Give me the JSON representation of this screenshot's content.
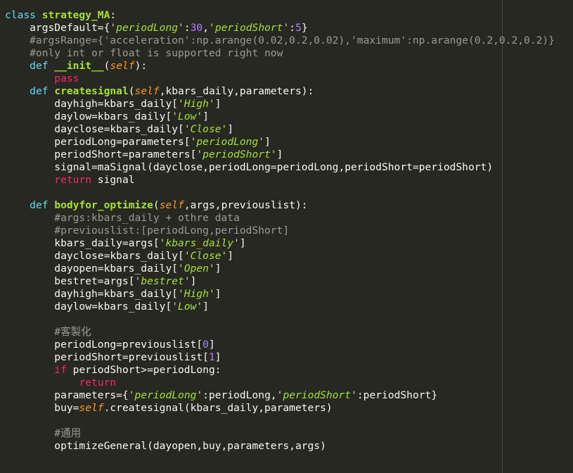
{
  "editor": {
    "lines": [
      [
        {
          "t": "class ",
          "c": "kw"
        },
        {
          "t": "strategy_MA",
          "c": "cls"
        },
        {
          "t": ":",
          "c": "plain"
        }
      ],
      [
        {
          "t": "    argsDefault={",
          "c": "plain"
        },
        {
          "t": "'",
          "c": "strq"
        },
        {
          "t": "periodLong",
          "c": "str"
        },
        {
          "t": "'",
          "c": "strq"
        },
        {
          "t": ":",
          "c": "plain"
        },
        {
          "t": "30",
          "c": "num"
        },
        {
          "t": ",",
          "c": "plain"
        },
        {
          "t": "'",
          "c": "strq"
        },
        {
          "t": "periodShort",
          "c": "str"
        },
        {
          "t": "'",
          "c": "strq"
        },
        {
          "t": ":",
          "c": "plain"
        },
        {
          "t": "5",
          "c": "num"
        },
        {
          "t": "}",
          "c": "plain"
        }
      ],
      [
        {
          "t": "    #argsRange={'acceleration':np.arange(0.02,0.2,0.02),'maximum':np.arange(0.2,0.2,0.2)}",
          "c": "cmt"
        }
      ],
      [
        {
          "t": "    #only int or float is supported right now",
          "c": "cmt"
        }
      ],
      [
        {
          "t": "    ",
          "c": "plain"
        },
        {
          "t": "def ",
          "c": "kw"
        },
        {
          "t": "__init__",
          "c": "fn"
        },
        {
          "t": "(",
          "c": "plain"
        },
        {
          "t": "self",
          "c": "self"
        },
        {
          "t": "):",
          "c": "plain"
        }
      ],
      [
        {
          "t": "        ",
          "c": "plain"
        },
        {
          "t": "pass",
          "c": "kw2"
        }
      ],
      [
        {
          "t": "    ",
          "c": "plain"
        },
        {
          "t": "def ",
          "c": "kw"
        },
        {
          "t": "createsignal",
          "c": "fn"
        },
        {
          "t": "(",
          "c": "plain"
        },
        {
          "t": "self",
          "c": "self"
        },
        {
          "t": ",kbars_daily,parameters):",
          "c": "plain"
        }
      ],
      [
        {
          "t": "        dayhigh=kbars_daily[",
          "c": "plain"
        },
        {
          "t": "'",
          "c": "strq"
        },
        {
          "t": "High",
          "c": "str"
        },
        {
          "t": "'",
          "c": "strq"
        },
        {
          "t": "]",
          "c": "plain"
        }
      ],
      [
        {
          "t": "        daylow=kbars_daily[",
          "c": "plain"
        },
        {
          "t": "'",
          "c": "strq"
        },
        {
          "t": "Low",
          "c": "str"
        },
        {
          "t": "'",
          "c": "strq"
        },
        {
          "t": "]",
          "c": "plain"
        }
      ],
      [
        {
          "t": "        dayclose=kbars_daily[",
          "c": "plain"
        },
        {
          "t": "'",
          "c": "strq"
        },
        {
          "t": "Close",
          "c": "str"
        },
        {
          "t": "'",
          "c": "strq"
        },
        {
          "t": "]",
          "c": "plain"
        }
      ],
      [
        {
          "t": "        periodLong=parameters[",
          "c": "plain"
        },
        {
          "t": "'",
          "c": "strq"
        },
        {
          "t": "periodLong",
          "c": "str"
        },
        {
          "t": "'",
          "c": "strq"
        },
        {
          "t": "]",
          "c": "plain"
        }
      ],
      [
        {
          "t": "        periodShort=parameters[",
          "c": "plain"
        },
        {
          "t": "'",
          "c": "strq"
        },
        {
          "t": "periodShort",
          "c": "str"
        },
        {
          "t": "'",
          "c": "strq"
        },
        {
          "t": "]",
          "c": "plain"
        }
      ],
      [
        {
          "t": "        signal=maSignal(dayclose,periodLong=periodLong,periodShort=periodShort)",
          "c": "plain"
        }
      ],
      [
        {
          "t": "        ",
          "c": "plain"
        },
        {
          "t": "return",
          "c": "kw2"
        },
        {
          "t": " signal",
          "c": "plain"
        }
      ],
      [],
      [
        {
          "t": "    ",
          "c": "plain"
        },
        {
          "t": "def ",
          "c": "kw"
        },
        {
          "t": "bodyfor_optimize",
          "c": "fn"
        },
        {
          "t": "(",
          "c": "plain"
        },
        {
          "t": "self",
          "c": "self"
        },
        {
          "t": ",args,previouslist):",
          "c": "plain"
        }
      ],
      [
        {
          "t": "        #args:kbars_daily + othre data",
          "c": "cmt"
        }
      ],
      [
        {
          "t": "        #previouslist:[periodLong,periodShort]",
          "c": "cmt"
        }
      ],
      [
        {
          "t": "        kbars_daily=args[",
          "c": "plain"
        },
        {
          "t": "'",
          "c": "strq"
        },
        {
          "t": "kbars_daily",
          "c": "str"
        },
        {
          "t": "'",
          "c": "strq"
        },
        {
          "t": "]",
          "c": "plain"
        }
      ],
      [
        {
          "t": "        dayclose=kbars_daily[",
          "c": "plain"
        },
        {
          "t": "'",
          "c": "strq"
        },
        {
          "t": "Close",
          "c": "str"
        },
        {
          "t": "'",
          "c": "strq"
        },
        {
          "t": "]",
          "c": "plain"
        }
      ],
      [
        {
          "t": "        dayopen=kbars_daily[",
          "c": "plain"
        },
        {
          "t": "'",
          "c": "strq"
        },
        {
          "t": "Open",
          "c": "str"
        },
        {
          "t": "'",
          "c": "strq"
        },
        {
          "t": "]",
          "c": "plain"
        }
      ],
      [
        {
          "t": "        bestret=args[",
          "c": "plain"
        },
        {
          "t": "'",
          "c": "strq"
        },
        {
          "t": "bestret",
          "c": "str"
        },
        {
          "t": "'",
          "c": "strq"
        },
        {
          "t": "]",
          "c": "plain"
        }
      ],
      [
        {
          "t": "        dayhigh=kbars_daily[",
          "c": "plain"
        },
        {
          "t": "'",
          "c": "strq"
        },
        {
          "t": "High",
          "c": "str"
        },
        {
          "t": "'",
          "c": "strq"
        },
        {
          "t": "]",
          "c": "plain"
        }
      ],
      [
        {
          "t": "        daylow=kbars_daily[",
          "c": "plain"
        },
        {
          "t": "'",
          "c": "strq"
        },
        {
          "t": "Low",
          "c": "str"
        },
        {
          "t": "'",
          "c": "strq"
        },
        {
          "t": "]",
          "c": "plain"
        }
      ],
      [],
      [
        {
          "t": "        #客製化",
          "c": "cmt"
        }
      ],
      [
        {
          "t": "        periodLong=previouslist[",
          "c": "plain"
        },
        {
          "t": "0",
          "c": "num"
        },
        {
          "t": "]",
          "c": "plain"
        }
      ],
      [
        {
          "t": "        periodShort=previouslist[",
          "c": "plain"
        },
        {
          "t": "1",
          "c": "num"
        },
        {
          "t": "]",
          "c": "plain"
        }
      ],
      [
        {
          "t": "        ",
          "c": "plain"
        },
        {
          "t": "if",
          "c": "kw2"
        },
        {
          "t": " periodShort>=periodLong:",
          "c": "plain"
        }
      ],
      [
        {
          "t": "            ",
          "c": "plain"
        },
        {
          "t": "return",
          "c": "kw2"
        }
      ],
      [
        {
          "t": "        parameters={",
          "c": "plain"
        },
        {
          "t": "'",
          "c": "strq"
        },
        {
          "t": "periodLong",
          "c": "str"
        },
        {
          "t": "'",
          "c": "strq"
        },
        {
          "t": ":periodLong,",
          "c": "plain"
        },
        {
          "t": "'",
          "c": "strq"
        },
        {
          "t": "periodShort",
          "c": "str"
        },
        {
          "t": "'",
          "c": "strq"
        },
        {
          "t": ":periodShort}",
          "c": "plain"
        }
      ],
      [
        {
          "t": "        buy=",
          "c": "plain"
        },
        {
          "t": "self",
          "c": "self"
        },
        {
          "t": ".createsignal(kbars_daily,parameters)",
          "c": "plain"
        }
      ],
      [],
      [
        {
          "t": "        #通用",
          "c": "cmt"
        }
      ],
      [
        {
          "t": "        optimizeGeneral(dayopen,buy,parameters,args)",
          "c": "plain"
        }
      ]
    ]
  }
}
